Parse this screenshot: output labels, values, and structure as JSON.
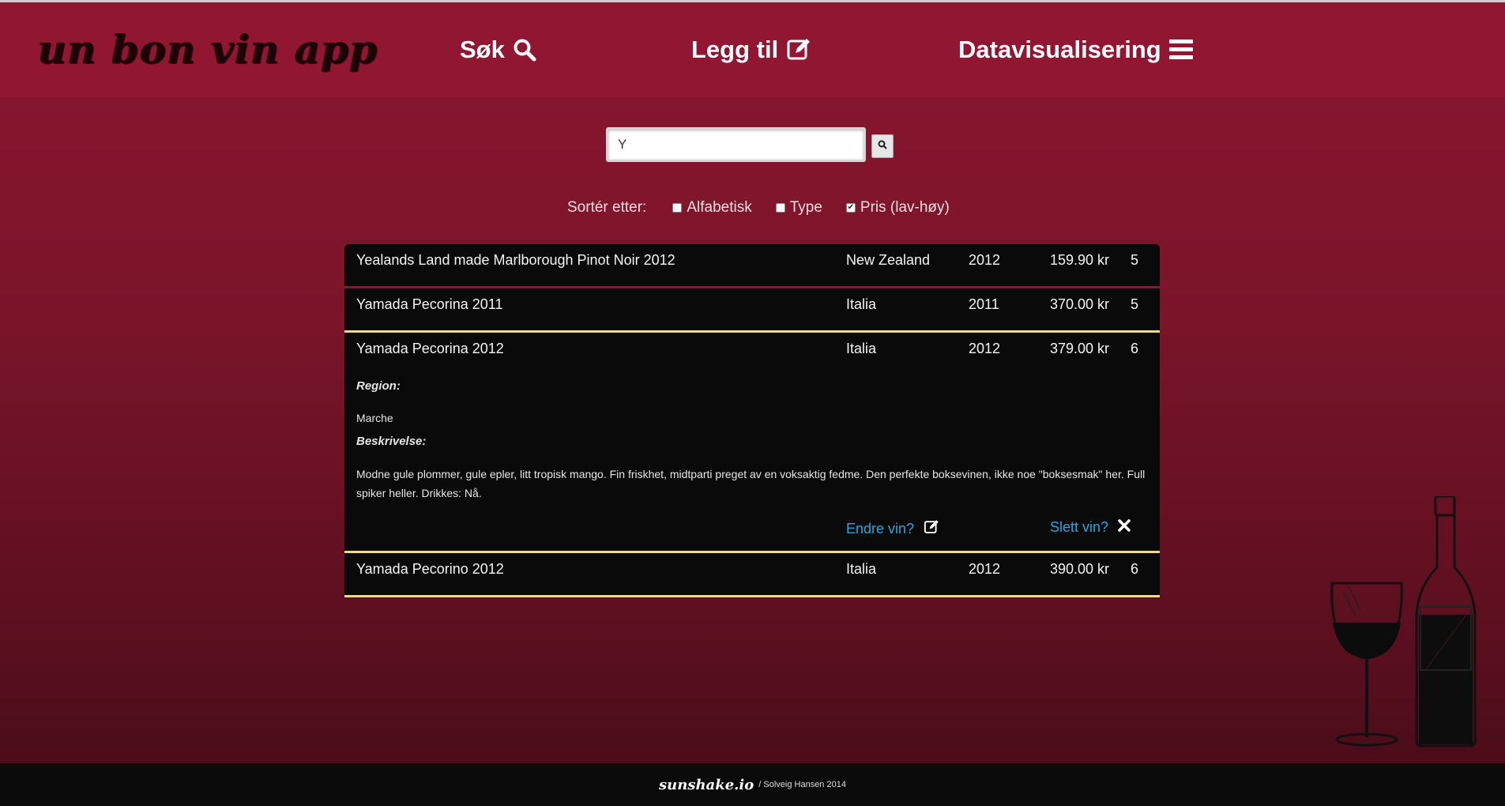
{
  "header": {
    "logo": "un bon vin app",
    "nav": [
      {
        "label": "Søk",
        "icon": "search-icon"
      },
      {
        "label": "Legg til",
        "icon": "edit-icon"
      },
      {
        "label": "Datavisualisering",
        "icon": "menu-icon"
      }
    ]
  },
  "search": {
    "value": "Y",
    "button_icon": "search-icon"
  },
  "sort": {
    "label": "Sortér etter:",
    "options": [
      {
        "label": "Alfabetisk",
        "checked": false
      },
      {
        "label": "Type",
        "checked": false
      },
      {
        "label": "Pris (lav-høy)",
        "checked": true
      }
    ]
  },
  "wines": [
    {
      "name": "Yealands Land made Marlborough Pinot Noir 2012",
      "country": "New Zealand",
      "year": "2012",
      "price": "159.90 kr",
      "rating": "5"
    },
    {
      "name": "Yamada Pecorina 2011",
      "country": "Italia",
      "year": "2011",
      "price": "370.00 kr",
      "rating": "5"
    },
    {
      "name": "Yamada Pecorina 2012",
      "country": "Italia",
      "year": "2012",
      "price": "379.00 kr",
      "rating": "6"
    },
    {
      "name": "Yamada Pecorino 2012",
      "country": "Italia",
      "year": "2012",
      "price": "390.00 kr",
      "rating": "6"
    }
  ],
  "detail": {
    "region_label": "Region:",
    "region": "Marche",
    "description_label": "Beskrivelse:",
    "description": "Modne gule plommer, gule epler, litt tropisk mango. Fin friskhet, midtparti preget av en voksaktig fedme. Den perfekte boksevinen, ikke noe \"boksesmak\" her. Full spiker heller. Drikkes: Nå.",
    "edit_label": "Endre vin?",
    "delete_label": "Slett vin?"
  },
  "footer": {
    "brand": "sunshake.io",
    "credit": "/ Solveig Hansen 2014"
  },
  "colors": {
    "header_bg": "#901632",
    "link": "#2aa6e0",
    "gold_separator": "#f3d98a",
    "list_bg": "#0a0a0a"
  }
}
